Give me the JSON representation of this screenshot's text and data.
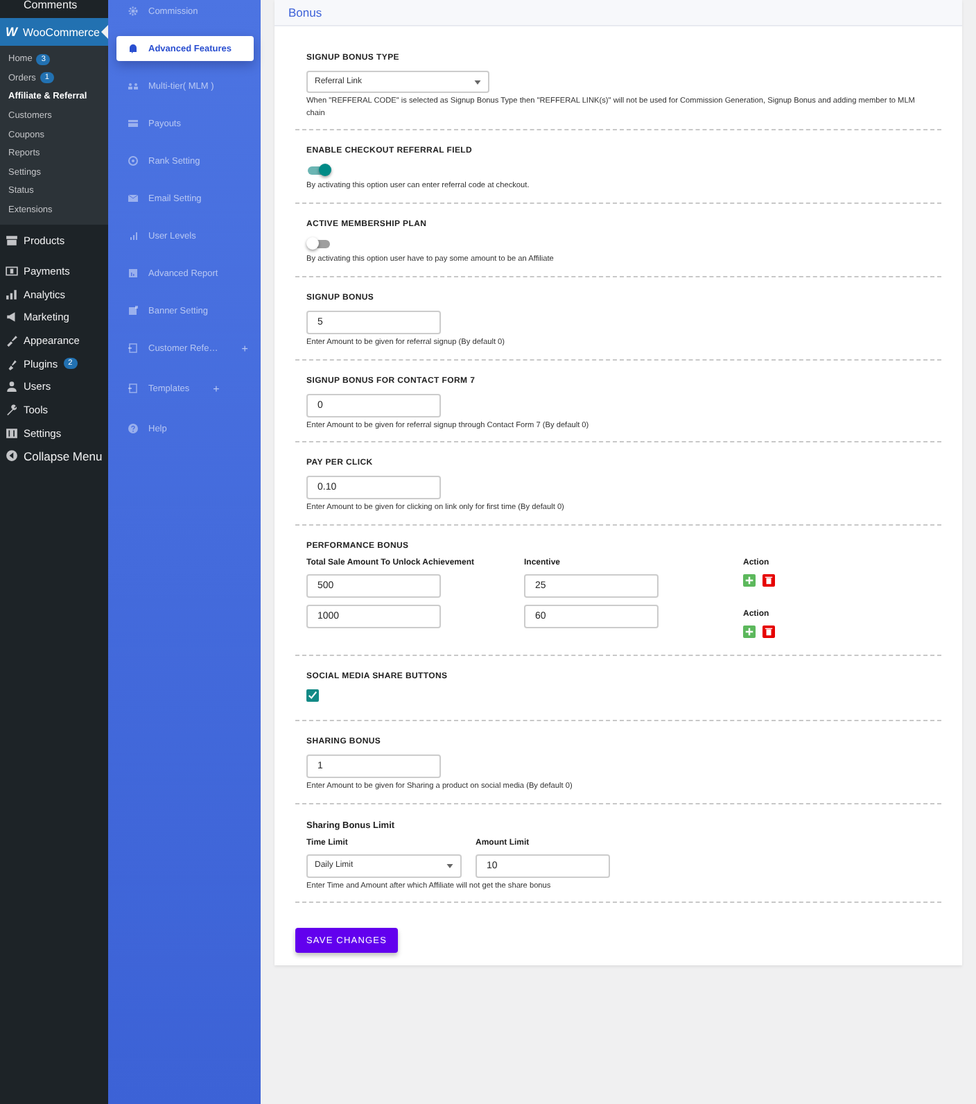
{
  "wp_menu": {
    "top_item": "Comments",
    "woocommerce": {
      "logo": "W",
      "label": "WooCommerce",
      "selected": true,
      "children": [
        {
          "label": "Home",
          "badge": "3",
          "selected": false
        },
        {
          "label": "Orders",
          "badge": "1",
          "selected": false
        },
        {
          "label": "Affiliate & Referral",
          "selected": true
        },
        {
          "label": "Customers",
          "selected": false
        },
        {
          "label": "Coupons",
          "selected": false
        },
        {
          "label": "Reports",
          "selected": false
        },
        {
          "label": "Settings",
          "selected": false
        },
        {
          "label": "Status",
          "selected": false
        },
        {
          "label": "Extensions",
          "selected": false
        }
      ]
    },
    "items": [
      {
        "label": "Products"
      },
      {
        "label": "Payments"
      },
      {
        "label": "Analytics"
      },
      {
        "label": "Marketing"
      },
      {
        "label": "Appearance"
      },
      {
        "label": "Plugins",
        "badge": "2"
      },
      {
        "label": "Users"
      },
      {
        "label": "Tools"
      },
      {
        "label": "Settings"
      },
      {
        "label": "Collapse Menu"
      }
    ]
  },
  "plugin_menu": [
    {
      "label": "Commission",
      "selected": false
    },
    {
      "label": "Advanced Features",
      "selected": true
    },
    {
      "label": "Multi-tier( MLM )",
      "selected": false
    },
    {
      "label": "Payouts",
      "selected": false
    },
    {
      "label": "Rank Setting",
      "selected": false
    },
    {
      "label": "Email Setting",
      "selected": false
    },
    {
      "label": "User Levels",
      "selected": false
    },
    {
      "label": "Advanced Report",
      "selected": false
    },
    {
      "label": "Banner Setting",
      "selected": false
    },
    {
      "label": "Customer Refe…",
      "selected": false,
      "expand_mark": "+"
    },
    {
      "label": "Templates",
      "selected": false,
      "expand_mark": "+"
    },
    {
      "label": "Help",
      "selected": false
    }
  ],
  "panel": {
    "title": "Bonus",
    "sections": [
      {
        "kind": "select",
        "label": "SIGNUP BONUS TYPE",
        "value": "Referral Link",
        "help": "When \"REFFERAL CODE\" is selected as Signup Bonus Type then \"REFFERAL LINK(s)\" will not be used for Commission Generation, Signup Bonus and adding member to MLM chain"
      },
      {
        "kind": "toggle",
        "label": "ENABLE CHECKOUT REFERRAL FIELD",
        "on": true,
        "help": "By activating this option user can enter referral code at checkout."
      },
      {
        "kind": "toggle",
        "label": "ACTIVE MEMBERSHIP PLAN",
        "on": false,
        "help": "By activating this option user have to pay some amount to be an Affiliate"
      },
      {
        "kind": "number",
        "label": "SIGNUP BONUS",
        "value": "5",
        "help": "Enter Amount to be given for referral signup (By default 0)"
      },
      {
        "kind": "number",
        "label": "SIGNUP BONUS FOR CONTACT FORM 7",
        "value": "0",
        "help": "Enter Amount to be given for referral signup through Contact Form 7 (By default 0)"
      },
      {
        "kind": "number",
        "label": "PAY PER CLICK",
        "value": "0.10",
        "help": "Enter Amount to be given for clicking on link only for first time (By default 0)"
      },
      {
        "kind": "performance",
        "label": "PERFORMANCE BONUS",
        "rows": [
          {
            "amount_label": "Total Sale Amount To Unlock Achievement",
            "amount": "500",
            "incentive_label": "Incentive",
            "incentive": "25",
            "action_label": "Action"
          },
          {
            "amount": "1000",
            "incentive": "60",
            "action_label": "Action"
          }
        ]
      },
      {
        "kind": "checkbox",
        "label": "SOCIAL MEDIA SHARE BUTTONS",
        "checked": true
      },
      {
        "kind": "number",
        "label": "SHARING BONUS",
        "value": "1",
        "help": "Enter Amount to be given for Sharing a product on social media (By default 0)"
      },
      {
        "kind": "limit",
        "label": "Sharing Bonus Limit",
        "time_label": "Time Limit",
        "time_value": "Daily Limit",
        "amount_label": "Amount Limit",
        "amount_value": "10",
        "help": "Enter Time and Amount after which Affiliate will not get the share bonus"
      }
    ],
    "save_button": "SAVE CHANGES"
  }
}
